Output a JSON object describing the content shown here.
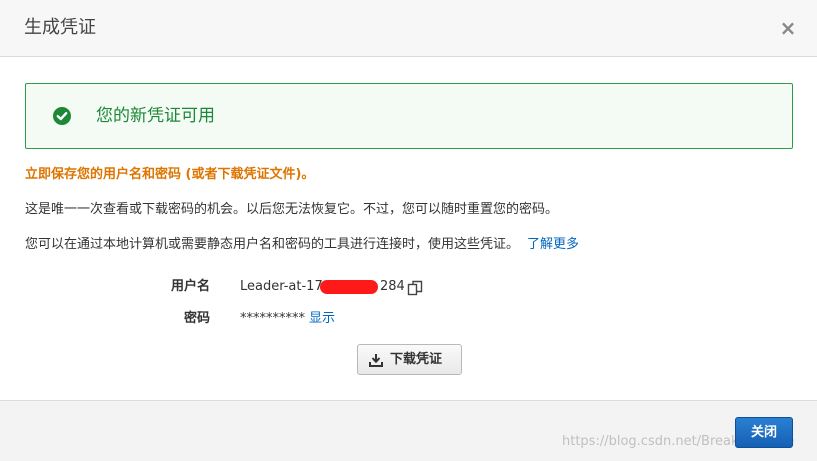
{
  "dialog": {
    "title": "生成凭证",
    "close_icon": "close-icon"
  },
  "success": {
    "icon": "check-circle-icon",
    "message": "您的新凭证可用",
    "color": "#1d8838"
  },
  "warning": {
    "text": "立即保存您的用户名和密码 (或者下载凭证文件)。",
    "color": "#dd7500"
  },
  "info": {
    "line1": "这是唯一一次查看或下载密码的机会。以后您无法恢复它。不过，您可以随时重置您的密码。",
    "line2": "您可以在通过本地计算机或需要静态用户名和密码的工具进行连接时，使用这些凭证。",
    "learn_more": "了解更多"
  },
  "credentials": {
    "username_label": "用户名",
    "username_prefix": "Leader-at-17",
    "username_suffix": "284",
    "copy_icon": "copy-icon",
    "password_label": "密码",
    "password_masked": "**********",
    "show_label": "显示"
  },
  "download": {
    "icon": "download-icon",
    "label": "下载凭证"
  },
  "footer": {
    "close_label": "关闭",
    "watermark": "https://blog.csdn.net/Breaksoftware",
    "accent": "#1a6cc4"
  }
}
